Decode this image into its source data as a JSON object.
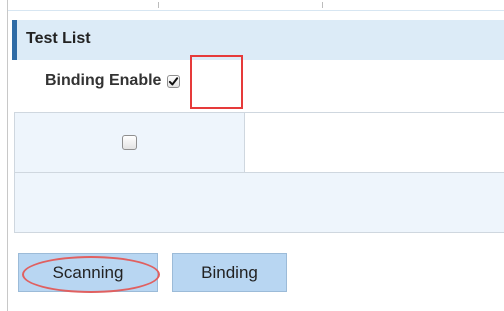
{
  "panel": {
    "title": "Test List"
  },
  "binding": {
    "label": "Binding Enable",
    "checked": true
  },
  "table": {
    "select_all_checked": false
  },
  "buttons": {
    "scanning_label": "Scanning",
    "binding_label": "Binding"
  },
  "colors": {
    "header_background": "#dcebf7",
    "header_accent": "#2f6ca6",
    "button_background": "#b8d6f2",
    "annotation_red": "#e63a3a"
  }
}
